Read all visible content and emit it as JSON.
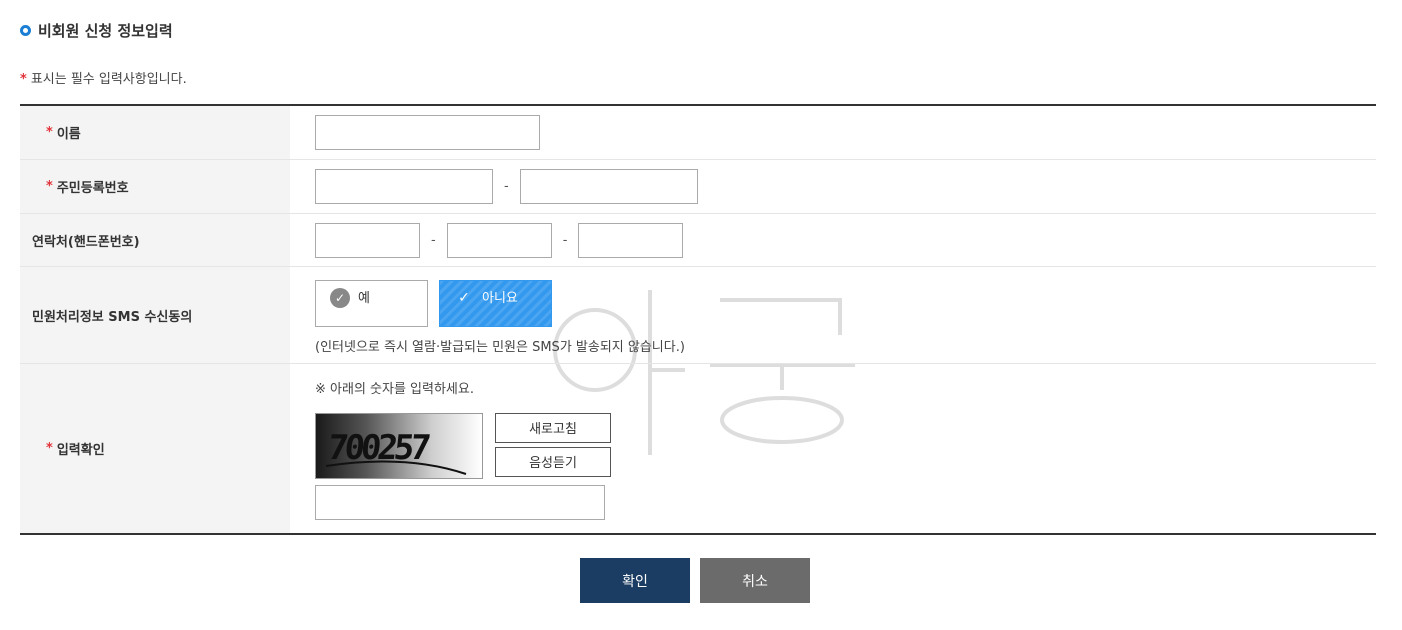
{
  "section_title": "비회원 신청 정보입력",
  "required_note": {
    "star": "*",
    "text": "표시는 필수 입력사항입니다."
  },
  "fields": {
    "name": {
      "star": "*",
      "label": "이름",
      "value": ""
    },
    "rrn": {
      "star": "*",
      "label": "주민등록번호",
      "value1": "",
      "value2": "",
      "separator": "-"
    },
    "phone": {
      "label": "연락처(핸드폰번호)",
      "value1": "",
      "value2": "",
      "value3": "",
      "separator": "-"
    },
    "sms": {
      "label": "민원처리정보 SMS 수신동의",
      "yes_label": "예",
      "no_label": "아니요",
      "selected": "아니요",
      "note": "(인터넷으로 즉시 열람·발급되는 민원은 SMS가 발송되지 않습니다.)"
    },
    "captcha": {
      "star": "*",
      "label": "입력확인",
      "guide": "※ 아래의 숫자를 입력하세요.",
      "image_text": "700257",
      "refresh_label": "새로고침",
      "audio_label": "음성듣기",
      "value": ""
    }
  },
  "actions": {
    "confirm_label": "확인",
    "cancel_label": "취소"
  },
  "colors": {
    "accent": "#1a7fd4",
    "required": "#e2343b",
    "selected_button": "#3399ee",
    "confirm_button": "#1c3d63",
    "cancel_button": "#6b6b6b"
  }
}
